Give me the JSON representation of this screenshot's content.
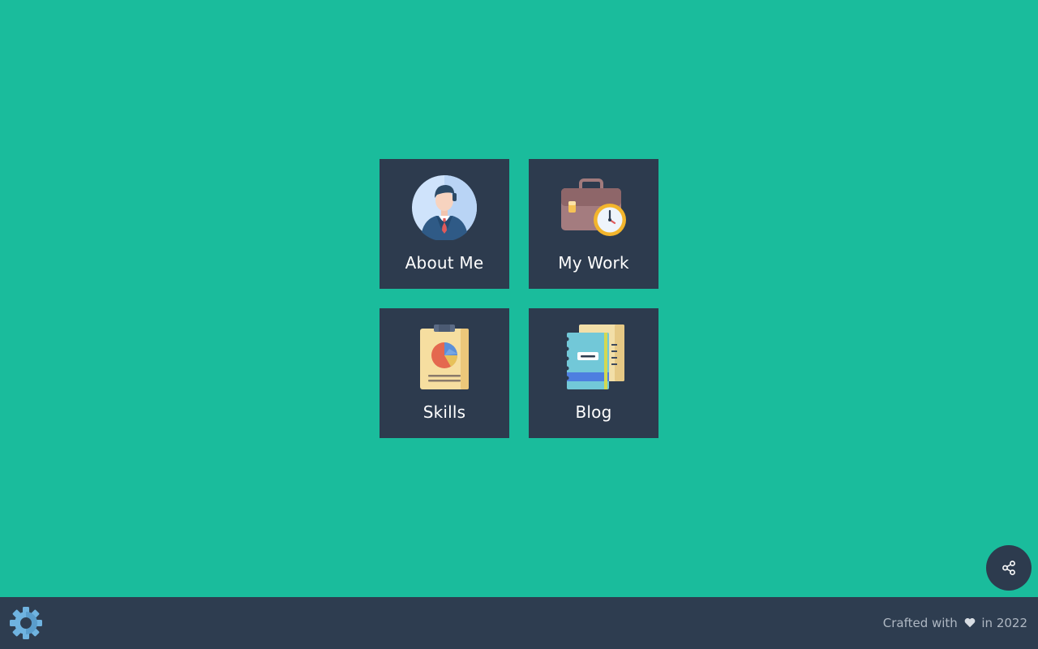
{
  "tiles": [
    {
      "label": "About Me",
      "icon": "businessman-avatar-icon"
    },
    {
      "label": "My Work",
      "icon": "briefcase-clock-icon"
    },
    {
      "label": "Skills",
      "icon": "clipboard-pie-chart-icon"
    },
    {
      "label": "Blog",
      "icon": "notebook-icon"
    }
  ],
  "share": {
    "icon": "share-icon"
  },
  "footer": {
    "settings_icon": "gear-icon",
    "credit_prefix": "Crafted with",
    "credit_heart_icon": "heart-icon",
    "credit_suffix": "in 2022"
  },
  "colors": {
    "background": "#1abc9c",
    "tile": "#2d3b4e",
    "footer": "#2e3d50"
  }
}
